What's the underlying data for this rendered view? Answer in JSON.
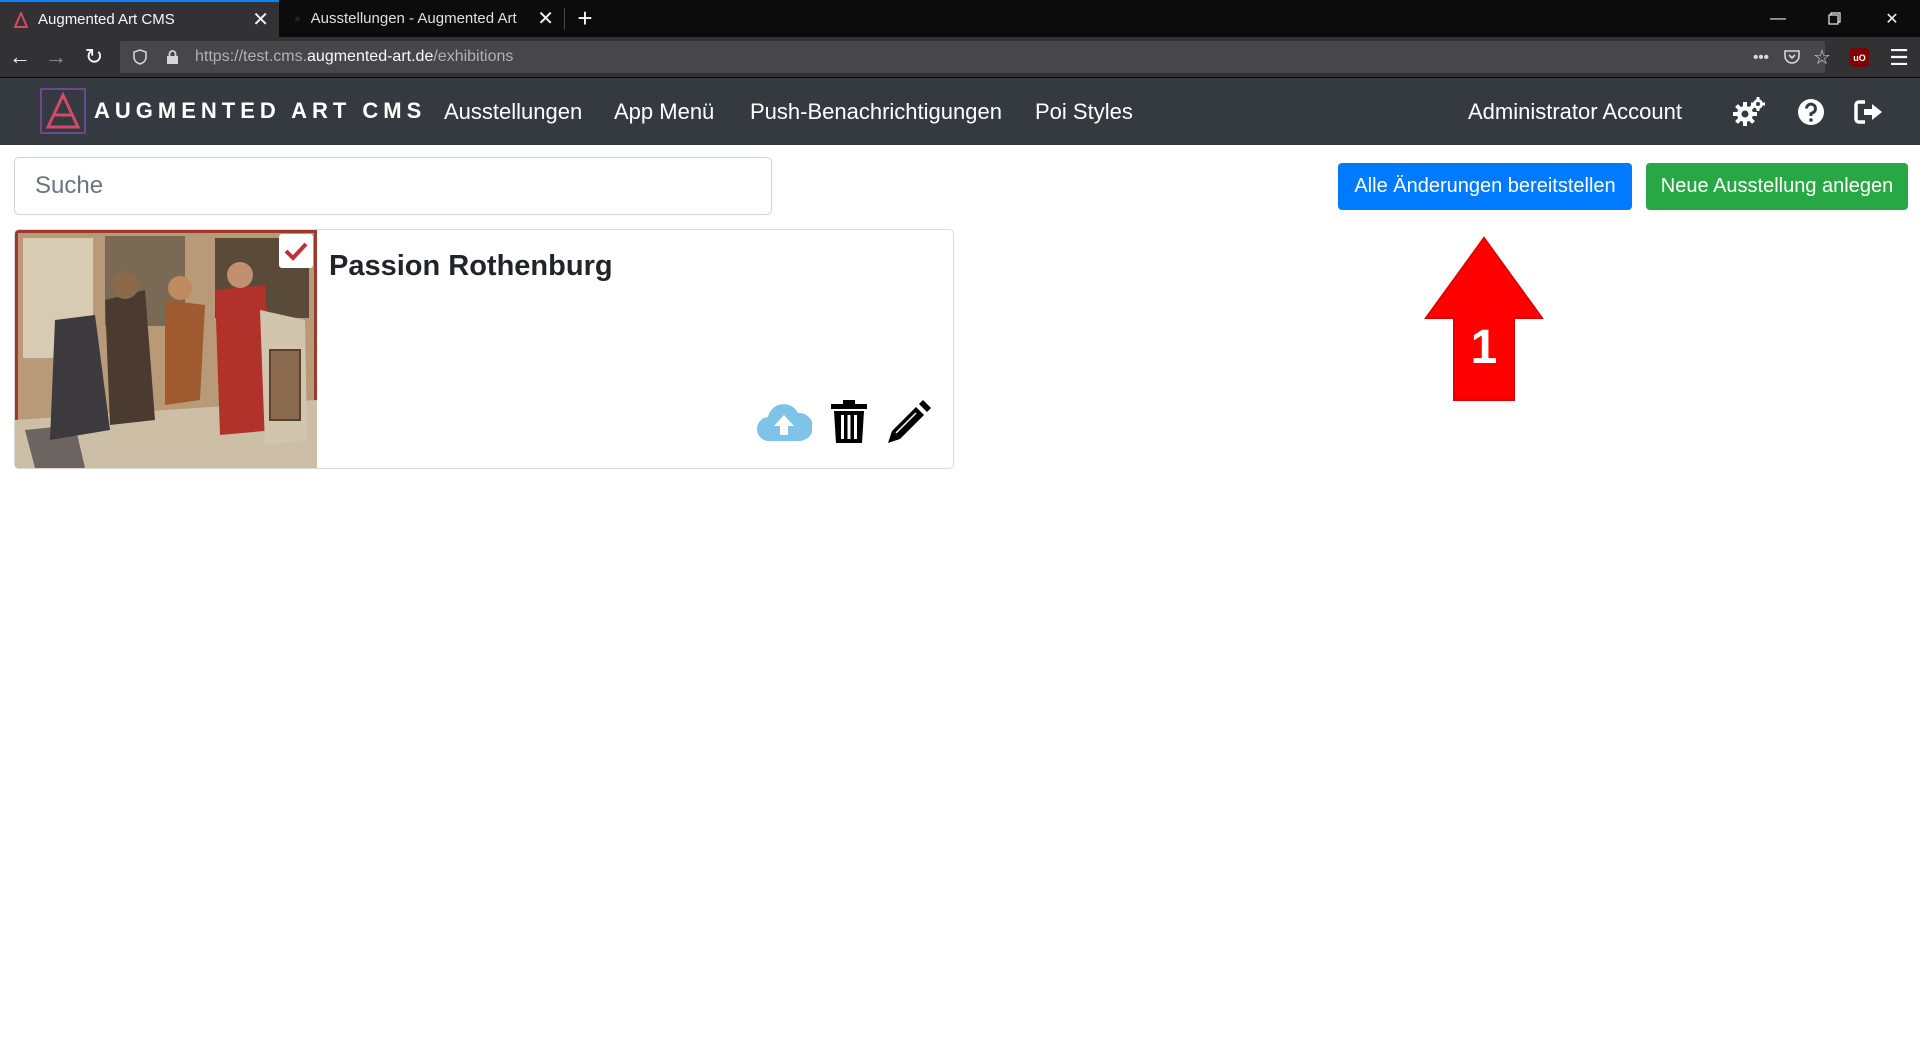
{
  "browser": {
    "tabs": [
      {
        "title": "Augmented Art CMS",
        "active": true
      },
      {
        "title": "Ausstellungen - Augmented Art",
        "active": false
      }
    ],
    "url": {
      "prefix": "https://test.cms.",
      "host": "augmented-art.de",
      "path": "/exhibitions"
    }
  },
  "header": {
    "brand": "AUGMENTED ART CMS",
    "menu": [
      "Ausstellungen",
      "App Menü",
      "Push-Benachrichtigungen",
      "Poi Styles"
    ],
    "account": "Administrator Account",
    "icons": [
      "settings-gears-icon",
      "help-icon",
      "logout-icon"
    ]
  },
  "toolbar": {
    "search_placeholder": "Suche",
    "deploy_label": "Alle Änderungen bereitstellen",
    "new_label": "Neue Ausstellung anlegen"
  },
  "exhibitions": [
    {
      "title": "Passion Rothenburg",
      "checked": true,
      "actions": [
        "cloud-upload-icon",
        "trash-icon",
        "pencil-icon"
      ]
    }
  ],
  "annotation": {
    "label": "1"
  },
  "colors": {
    "primary": "#007bff",
    "success": "#28a745",
    "header_bg": "#343a40",
    "annotation": "#ff0000"
  }
}
